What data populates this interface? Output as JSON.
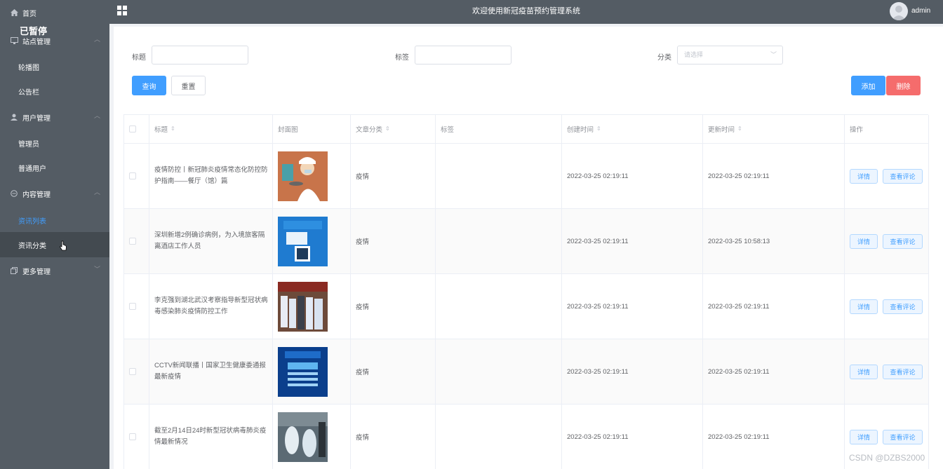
{
  "overlay": {
    "paused_text": "已暂停"
  },
  "sidebar": {
    "home": "首页",
    "site_mgmt": "站点管理",
    "carousel": "轮播图",
    "notice": "公告栏",
    "user_mgmt": "用户管理",
    "admins": "管理员",
    "normal_users": "普通用户",
    "content_mgmt": "内容管理",
    "news_list": "资讯列表",
    "news_category": "资讯分类",
    "more_mgmt": "更多管理"
  },
  "header": {
    "title": "欢迎使用新冠疫苗预约管理系统",
    "username": "admin"
  },
  "search": {
    "title_label": "标题",
    "tag_label": "标签",
    "category_label": "分类",
    "category_placeholder": "请选择",
    "query_button": "查询",
    "reset_button": "重置",
    "add_button": "添加",
    "delete_button": "删除"
  },
  "table": {
    "headers": {
      "title": "标题",
      "cover": "封面图",
      "category": "文章分类",
      "tag": "标签",
      "created": "创建时间",
      "updated": "更新时间",
      "actions": "操作"
    },
    "rows": [
      {
        "title": "疫情防控丨新冠肺炎疫情常态化防控防护指南——餐厅（馆）篇",
        "category": "疫情",
        "tag": "",
        "created": "2022-03-25 02:19:11",
        "updated": "2022-03-25 02:19:11",
        "detail": "详情",
        "comments": "查看评论"
      },
      {
        "title": "深圳新增2例确诊病例，为入境旅客隔离酒店工作人员",
        "category": "疫情",
        "tag": "",
        "created": "2022-03-25 02:19:11",
        "updated": "2022-03-25 10:58:13",
        "detail": "详情",
        "comments": "查看评论"
      },
      {
        "title": "李克强到湖北武汉考察指导新型冠状病毒感染肺炎疫情防控工作",
        "category": "疫情",
        "tag": "",
        "created": "2022-03-25 02:19:11",
        "updated": "2022-03-25 02:19:11",
        "detail": "详情",
        "comments": "查看评论"
      },
      {
        "title": "CCTV新闻联播丨国家卫生健康委通报最新疫情",
        "category": "疫情",
        "tag": "",
        "created": "2022-03-25 02:19:11",
        "updated": "2022-03-25 02:19:11",
        "detail": "详情",
        "comments": "查看评论"
      },
      {
        "title": "截至2月14日24时新型冠状病毒肺炎疫情最新情况",
        "category": "疫情",
        "tag": "",
        "created": "2022-03-25 02:19:11",
        "updated": "2022-03-25 02:19:11",
        "detail": "详情",
        "comments": "查看评论"
      }
    ]
  },
  "watermark": "CSDN @DZBS2000",
  "colors": {
    "sidebar_bg": "#545c64",
    "primary": "#409eff",
    "danger": "#f56c6c",
    "active_menu": "#409eff"
  }
}
